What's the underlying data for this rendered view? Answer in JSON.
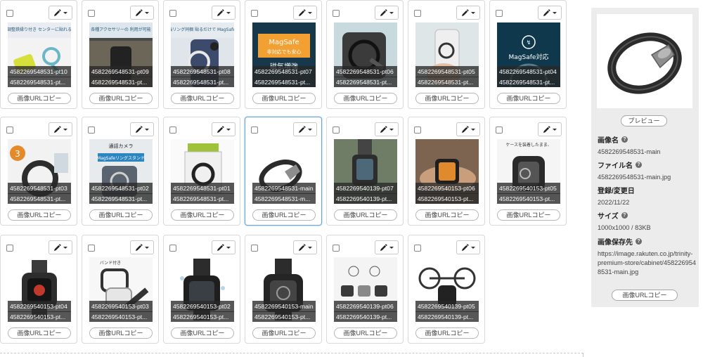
{
  "cards": [
    {
      "label1": "4582269548531-pt10",
      "label2": "4582269548531-pt...",
      "selected": false,
      "thumb": "ring-on-yellow-charger",
      "banner": "仕組みし簡単、調整鉄縁り付き センターに貼れる給付ツール同梱"
    },
    {
      "label1": "4582269548531-pt09",
      "label2": "4582269548531-pt...",
      "selected": false,
      "thumb": "car-dashboard-phone",
      "banner": "各種アクセサリーの 利用が可能"
    },
    {
      "label1": "4582269548531-pt08",
      "label2": "4582269548531-pt...",
      "selected": false,
      "thumb": "phone-back-ring",
      "banner": "磁気増強リング同梱 貼るだけで MagSafe 対応に"
    },
    {
      "label1": "4582269548531-pt07",
      "label2": "4582269548531-pt...",
      "selected": false,
      "thumb": "magsafe-orange-box",
      "banner": "MagSafe 非対応でも安心 磁気増強"
    },
    {
      "label1": "4582269548531-pt06",
      "label2": "4582269548531-pt...",
      "selected": false,
      "thumb": "phone-ring-stand",
      "banner": ""
    },
    {
      "label1": "4582269548531-pt05",
      "label2": "4582269548531-pt...",
      "selected": false,
      "thumb": "hand-phone-ring",
      "banner": ""
    },
    {
      "label1": "4582269548531-pt04",
      "label2": "4582269548531-pt...",
      "selected": false,
      "thumb": "magsafe-blue",
      "banner": "MagSafe対応"
    },
    {
      "label1": "4582269548531-pt03",
      "label2": "4582269548531-pt...",
      "selected": false,
      "thumb": "ring-3-step",
      "banner": "3"
    },
    {
      "label1": "4582269548531-pt02",
      "label2": "4582269548531-pt...",
      "selected": false,
      "thumb": "camera-ring-stand",
      "banner": "通話カメラ MagSafeリングスタンド"
    },
    {
      "label1": "4582269548531-pt01",
      "label2": "4582269548531-pt...",
      "selected": false,
      "thumb": "ring-package",
      "banner": ""
    },
    {
      "label1": "4582269548531-main",
      "label2": "4582269548531-m...",
      "selected": true,
      "thumb": "ring-main",
      "banner": ""
    },
    {
      "label1": "4582269540139-pt07",
      "label2": "4582269540139-pt...",
      "selected": false,
      "thumb": "watch-outdoor",
      "banner": ""
    },
    {
      "label1": "4582269540153-pt06",
      "label2": "4582269540153-pt...",
      "selected": false,
      "thumb": "watch-orange-wrist",
      "banner": ""
    },
    {
      "label1": "4582269540153-pt05",
      "label2": "4582269540153-pt...",
      "selected": false,
      "thumb": "watch-case-dark",
      "banner": ""
    },
    {
      "label1": "4582269540153-pt04",
      "label2": "4582269540153-pt...",
      "selected": false,
      "thumb": "watch-red-face",
      "banner": ""
    },
    {
      "label1": "4582269540153-pt03",
      "label2": "4582269540153-pt...",
      "selected": false,
      "thumb": "watch-case-exploded",
      "banner": ""
    },
    {
      "label1": "4582269540153-pt02",
      "label2": "4582269540153-pt...",
      "selected": false,
      "thumb": "watch-splash",
      "banner": ""
    },
    {
      "label1": "4582269540153-main",
      "label2": "4582269540153-pt...",
      "selected": false,
      "thumb": "watch-main",
      "banner": ""
    },
    {
      "label1": "4582269540139-pt06",
      "label2": "4582269540139-pt...",
      "selected": false,
      "thumb": "watch-accessories",
      "banner": ""
    },
    {
      "label1": "4582269540139-pt05",
      "label2": "4582269540139-pt...",
      "selected": false,
      "thumb": "watch-bike",
      "banner": ""
    }
  ],
  "card_copy_label": "画像URLコピー",
  "side": {
    "preview_button": "プレビュー",
    "image_name_label": "画像名",
    "image_name_value": "4582269548531-main",
    "file_name_label": "ファイル名",
    "file_name_value": "4582269548531-main.jpg",
    "date_label": "登録/変更日",
    "date_value": "2022/11/22",
    "size_label": "サイズ",
    "size_value": "1000x1000 / 83KB",
    "path_label": "画像保存先",
    "path_value": "https://image.rakuten.co.jp/trinity-premium-store/cabinet/4582269548531-main.jpg",
    "copy_button": "画像URLコピー",
    "help_glyph": "?"
  },
  "colors": {
    "selected_border": "#6aa3d6",
    "label_bg": "#282828",
    "side_bg": "#ececec"
  }
}
